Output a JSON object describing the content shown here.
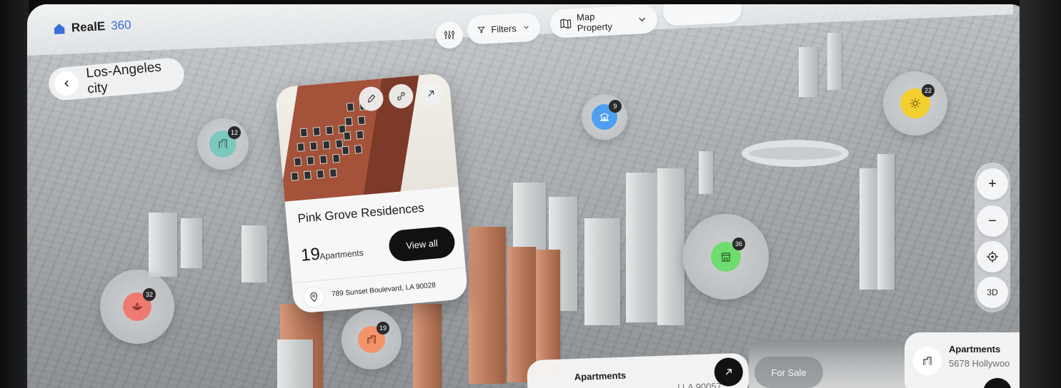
{
  "app": {
    "brand_name": "RealE",
    "brand_number": "360"
  },
  "toolbar": {
    "filters_label": "Filters",
    "map_label": "Map Property"
  },
  "location": {
    "city": "Los-Angeles city"
  },
  "property_card": {
    "title": "Pink Grove Residences",
    "count": "19",
    "count_label": "Apartments",
    "view_all": "View all",
    "address": "789 Sunset Boulevard, LA 90028"
  },
  "markers": [
    {
      "count": "12",
      "color": "#7cc9bd",
      "icon": "building-icon"
    },
    {
      "count": "9",
      "color": "#4d9ff0",
      "icon": "pagoda-icon"
    },
    {
      "count": "22",
      "color": "#f3cf2f",
      "icon": "sun-icon"
    },
    {
      "count": "36",
      "color": "#6fdc6f",
      "icon": "store-icon"
    },
    {
      "count": "32",
      "color": "#ef7a72",
      "icon": "lotus-icon"
    },
    {
      "count": "19",
      "color": "#f2936a",
      "icon": "apartment-icon"
    }
  ],
  "map_controls": {
    "zoom_in": "+",
    "zoom_out": "−",
    "mode": "3D"
  },
  "bottom_cards": {
    "left": {
      "title": "Apartments",
      "subtitle": "l LA 90057"
    },
    "right": {
      "title": "Apartments",
      "subtitle": "5678 Hollywoo"
    },
    "badge": "For Sale"
  },
  "colors": {
    "accent": "#3a6fd8",
    "dark_button": "#111111"
  }
}
